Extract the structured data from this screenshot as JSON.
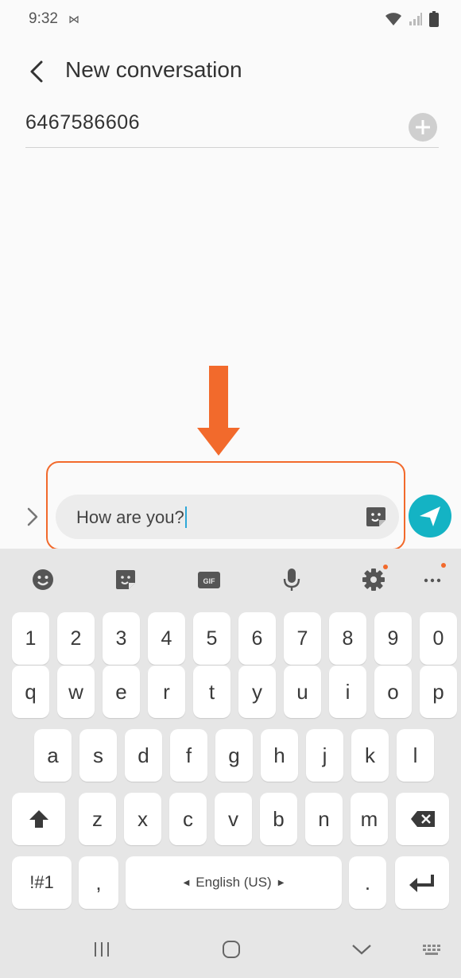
{
  "status_bar": {
    "time": "9:32",
    "left_icon": "⋈"
  },
  "header": {
    "title": "New conversation"
  },
  "recipient": {
    "value": "6467586606"
  },
  "compose": {
    "text": "How are you?"
  },
  "colors": {
    "accent": "#14b3c4",
    "highlight": "#f26a2c",
    "keyboard_bg": "#e6e6e6"
  },
  "keyboard": {
    "toolbar_icons": [
      "emoji-icon",
      "sticker-icon",
      "gif-icon",
      "mic-icon",
      "settings-icon",
      "more-icon"
    ],
    "gif_label": "GIF",
    "number_row": [
      "1",
      "2",
      "3",
      "4",
      "5",
      "6",
      "7",
      "8",
      "9",
      "0"
    ],
    "row1": [
      "q",
      "w",
      "e",
      "r",
      "t",
      "y",
      "u",
      "i",
      "o",
      "p"
    ],
    "row2": [
      "a",
      "s",
      "d",
      "f",
      "g",
      "h",
      "j",
      "k",
      "l"
    ],
    "row3": [
      "z",
      "x",
      "c",
      "v",
      "b",
      "n",
      "m"
    ],
    "symbols_label": "!#1",
    "comma": ",",
    "space_label": "English (US)",
    "period": "."
  }
}
